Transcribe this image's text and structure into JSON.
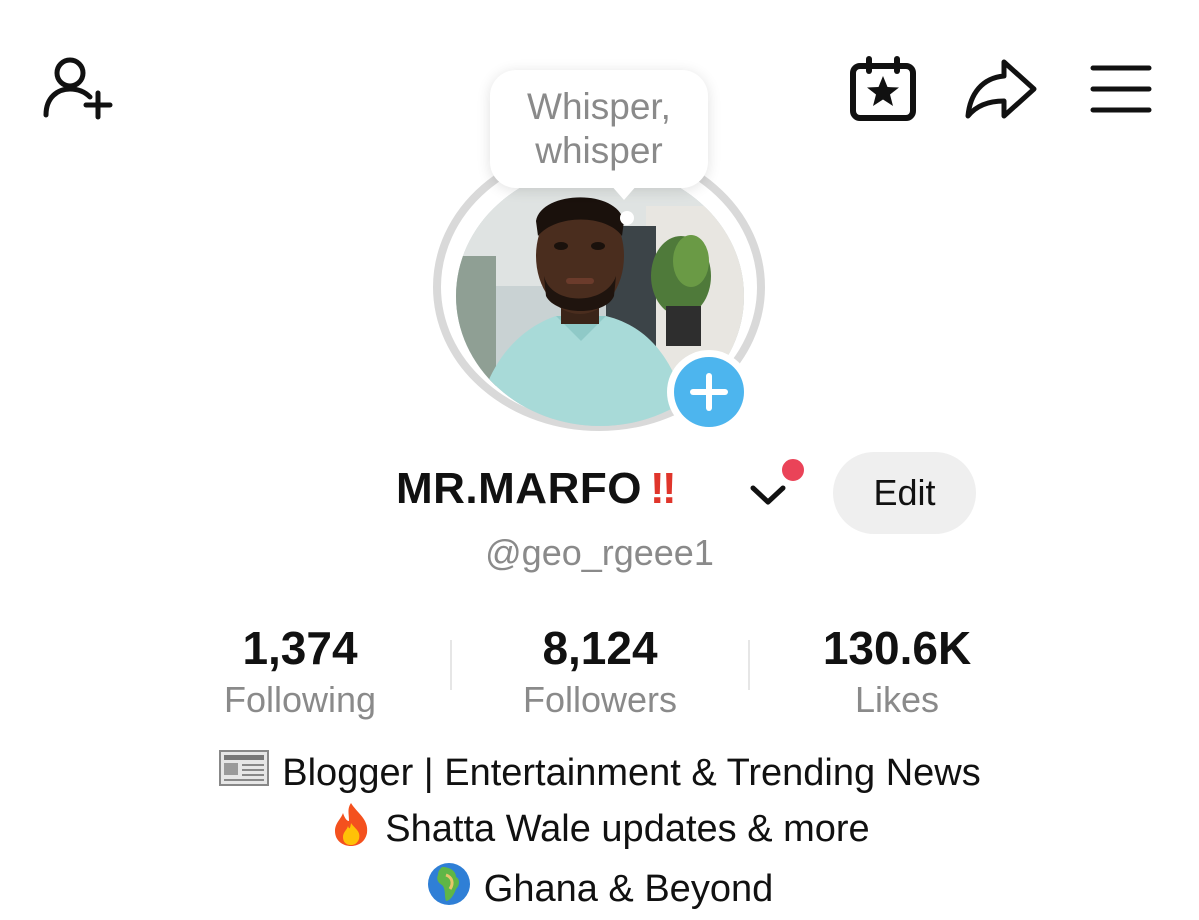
{
  "header": {
    "add_friend_icon": "add-user-icon",
    "calendar_icon": "calendar-star-icon",
    "share_icon": "share-arrow-icon",
    "menu_icon": "hamburger-menu-icon"
  },
  "profile": {
    "note_bubble": "Whisper, whisper",
    "name": "MR.MARFO",
    "name_suffix": "‼",
    "handle": "@geo_rgeee1",
    "edit_label": "Edit",
    "accent_color": "#4db5ee",
    "notification_color": "#ea4358"
  },
  "stats": [
    {
      "value": "1,374",
      "label": "Following"
    },
    {
      "value": "8,124",
      "label": "Followers"
    },
    {
      "value": "130.6K",
      "label": "Likes"
    }
  ],
  "bio": [
    {
      "icon": "newspaper-emoji",
      "text": "Blogger | Entertainment & Trending News"
    },
    {
      "icon": "fire-emoji",
      "text": "Shatta Wale updates & more"
    },
    {
      "icon": "globe-africa-emoji",
      "text": "Ghana & Beyond"
    }
  ]
}
